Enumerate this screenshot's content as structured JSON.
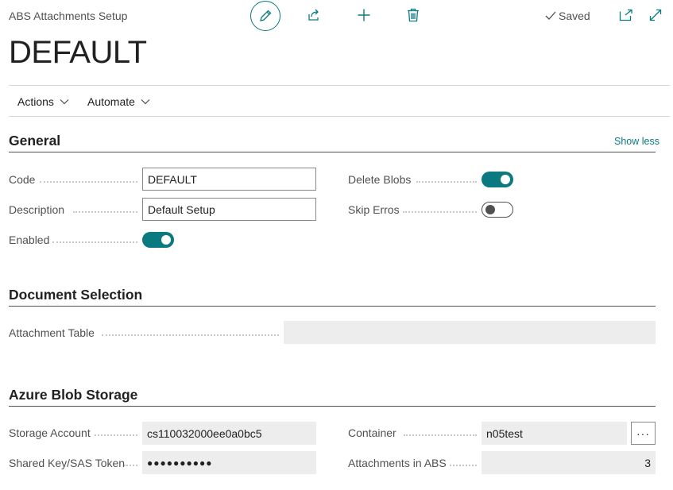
{
  "header": {
    "caption": "ABS Attachments Setup",
    "title": "DEFAULT",
    "status": "Saved"
  },
  "actions": {
    "menus": [
      "Actions",
      "Automate"
    ]
  },
  "general": {
    "title": "General",
    "show_less": "Show less",
    "fields": {
      "code_label": "Code",
      "code_value": "DEFAULT",
      "description_label": "Description",
      "description_value": "Default Setup",
      "enabled_label": "Enabled",
      "enabled": true,
      "delete_blobs_label": "Delete Blobs",
      "delete_blobs": true,
      "skip_erros_label": "Skip Erros",
      "skip_erros": false
    }
  },
  "document_selection": {
    "title": "Document Selection",
    "attachment_table_label": "Attachment Table",
    "attachment_table_value": ""
  },
  "azure_blob_storage": {
    "title": "Azure Blob Storage",
    "storage_account_label": "Storage Account",
    "storage_account_value": "cs110032000ee0a0bc5",
    "shared_key_label": "Shared Key/SAS Token",
    "shared_key_value": "●●●●●●●●●●",
    "container_label": "Container",
    "container_value": "n05test",
    "container_lookup": "···",
    "attachments_label": "Attachments in ABS",
    "attachments_value": "3"
  },
  "colors": {
    "accent": "#0a7a80",
    "label": "#505050",
    "readonly_bg": "#ededed"
  },
  "icons": [
    "edit-icon",
    "share-icon",
    "add-icon",
    "delete-icon",
    "check-icon",
    "popout-icon",
    "expand-icon",
    "chevron-down-icon"
  ]
}
